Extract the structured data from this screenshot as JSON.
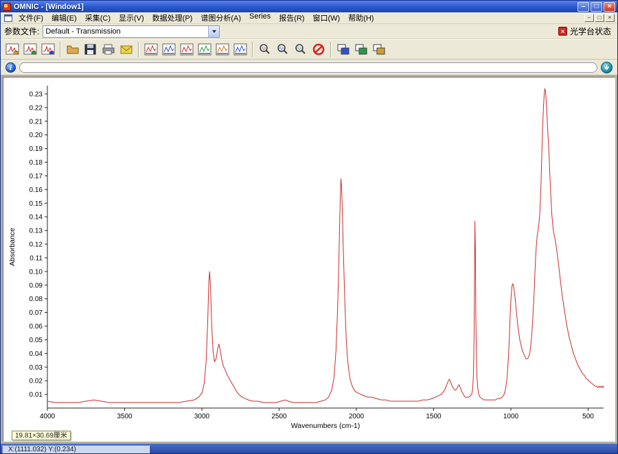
{
  "window": {
    "title": "OMNIC - [Window1]",
    "controls": {
      "minimize": "–",
      "restore": "□",
      "close": "×"
    }
  },
  "menu": {
    "items": [
      "文件(F)",
      "编辑(E)",
      "采集(C)",
      "显示(V)",
      "数据处理(P)",
      "谱图分析(A)",
      "Series",
      "报告(R)",
      "窗口(W)",
      "帮助(H)"
    ]
  },
  "mdi_controls": {
    "minimize": "–",
    "restore": "□",
    "close": "×"
  },
  "param_bar": {
    "label": "参数文件:",
    "selected": "Default - Transmission",
    "bench_status_label": "光学台状态"
  },
  "toolbar": {
    "groups": [
      [
        {
          "name": "experiment-setup-button",
          "icon": "spectrum-doc",
          "accent": "#e0a000"
        },
        {
          "name": "collect-background-button",
          "icon": "spectrum-doc",
          "accent": "#28a028"
        },
        {
          "name": "collect-sample-button",
          "icon": "spectrum-doc",
          "accent": "#2848d0"
        }
      ],
      [
        {
          "name": "open-button",
          "icon": "folder",
          "accent": "#dcaa50"
        },
        {
          "name": "save-button",
          "icon": "floppy",
          "accent": "#303850"
        },
        {
          "name": "print-button",
          "icon": "printer",
          "accent": "#9aa0a8"
        },
        {
          "name": "email-button",
          "icon": "mail",
          "accent": "#ecd24a"
        }
      ],
      [
        {
          "name": "full-scale-button",
          "icon": "chart",
          "accent": "#d03030"
        },
        {
          "name": "autoscale-button",
          "icon": "chart",
          "accent": "#3050d0"
        },
        {
          "name": "common-scale-button",
          "icon": "chart",
          "accent": "#d03030"
        },
        {
          "name": "match-scale-button",
          "icon": "chart",
          "accent": "#2a9a4a"
        },
        {
          "name": "offset-spectra-button",
          "icon": "chart",
          "accent": "#d07828"
        },
        {
          "name": "stack-spectra-button",
          "icon": "chart",
          "accent": "#3050d0"
        }
      ],
      [
        {
          "name": "find-peaks-button",
          "icon": "magnifier",
          "accent": "#d03030"
        },
        {
          "name": "zoom-button",
          "icon": "magnifier",
          "accent": "#3050d0"
        },
        {
          "name": "library-search-button",
          "icon": "magnifier",
          "accent": "#2a9a4a"
        },
        {
          "name": "spectral-id-button",
          "icon": "ban",
          "accent": "#d02020"
        }
      ],
      [
        {
          "name": "copy-window-button",
          "icon": "windows",
          "accent": "#3050d0"
        },
        {
          "name": "paste-window-button",
          "icon": "windows",
          "accent": "#2a9a4a"
        },
        {
          "name": "new-window-button",
          "icon": "windows",
          "accent": "#d0a030"
        }
      ]
    ]
  },
  "info_bar": {
    "value": ""
  },
  "chart_data": {
    "type": "line",
    "title": "",
    "xlabel": "Wavenumbers (cm-1)",
    "ylabel": "Absorbance",
    "x_axis_reversed": true,
    "x_range": [
      4000,
      400
    ],
    "x_ticks": [
      4000,
      3500,
      3000,
      2500,
      2000,
      1500,
      1000,
      500
    ],
    "y_min": 0.0,
    "y_max": 0.236,
    "y_ticks": [
      0.01,
      0.02,
      0.03,
      0.04,
      0.05,
      0.06,
      0.07,
      0.08,
      0.09,
      0.1,
      0.11,
      0.12,
      0.13,
      0.14,
      0.15,
      0.16,
      0.17,
      0.18,
      0.19,
      0.2,
      0.21,
      0.22,
      0.23
    ],
    "grid": false,
    "legend": false,
    "line_color": "#cc2a2a",
    "series_name": "IR absorbance spectrum",
    "points": [
      [
        4000,
        0.005
      ],
      [
        3950,
        0.004
      ],
      [
        3900,
        0.004
      ],
      [
        3850,
        0.004
      ],
      [
        3800,
        0.004
      ],
      [
        3750,
        0.005
      ],
      [
        3700,
        0.006
      ],
      [
        3650,
        0.005
      ],
      [
        3600,
        0.004
      ],
      [
        3550,
        0.004
      ],
      [
        3500,
        0.004
      ],
      [
        3450,
        0.004
      ],
      [
        3400,
        0.004
      ],
      [
        3350,
        0.004
      ],
      [
        3300,
        0.004
      ],
      [
        3250,
        0.004
      ],
      [
        3200,
        0.004
      ],
      [
        3150,
        0.004
      ],
      [
        3100,
        0.005
      ],
      [
        3050,
        0.006
      ],
      [
        3020,
        0.008
      ],
      [
        3000,
        0.011
      ],
      [
        2985,
        0.018
      ],
      [
        2972,
        0.035
      ],
      [
        2962,
        0.065
      ],
      [
        2955,
        0.092
      ],
      [
        2950,
        0.1
      ],
      [
        2944,
        0.088
      ],
      [
        2936,
        0.06
      ],
      [
        2928,
        0.042
      ],
      [
        2918,
        0.034
      ],
      [
        2908,
        0.036
      ],
      [
        2898,
        0.043
      ],
      [
        2890,
        0.047
      ],
      [
        2882,
        0.043
      ],
      [
        2872,
        0.036
      ],
      [
        2862,
        0.031
      ],
      [
        2850,
        0.028
      ],
      [
        2835,
        0.024
      ],
      [
        2820,
        0.021
      ],
      [
        2805,
        0.018
      ],
      [
        2790,
        0.015
      ],
      [
        2775,
        0.012
      ],
      [
        2760,
        0.01
      ],
      [
        2740,
        0.008
      ],
      [
        2720,
        0.007
      ],
      [
        2700,
        0.006
      ],
      [
        2670,
        0.005
      ],
      [
        2640,
        0.005
      ],
      [
        2600,
        0.004
      ],
      [
        2560,
        0.004
      ],
      [
        2520,
        0.004
      ],
      [
        2490,
        0.005
      ],
      [
        2460,
        0.006
      ],
      [
        2440,
        0.005
      ],
      [
        2410,
        0.004
      ],
      [
        2380,
        0.004
      ],
      [
        2350,
        0.004
      ],
      [
        2320,
        0.004
      ],
      [
        2290,
        0.004
      ],
      [
        2260,
        0.004
      ],
      [
        2230,
        0.005
      ],
      [
        2200,
        0.006
      ],
      [
        2180,
        0.008
      ],
      [
        2160,
        0.013
      ],
      [
        2145,
        0.022
      ],
      [
        2132,
        0.042
      ],
      [
        2122,
        0.072
      ],
      [
        2114,
        0.105
      ],
      [
        2108,
        0.138
      ],
      [
        2103,
        0.158
      ],
      [
        2100,
        0.168
      ],
      [
        2096,
        0.162
      ],
      [
        2091,
        0.145
      ],
      [
        2086,
        0.122
      ],
      [
        2080,
        0.098
      ],
      [
        2073,
        0.072
      ],
      [
        2066,
        0.052
      ],
      [
        2058,
        0.037
      ],
      [
        2050,
        0.028
      ],
      [
        2040,
        0.021
      ],
      [
        2030,
        0.017
      ],
      [
        2018,
        0.014
      ],
      [
        2005,
        0.012
      ],
      [
        1990,
        0.011
      ],
      [
        1970,
        0.01
      ],
      [
        1950,
        0.009
      ],
      [
        1925,
        0.008
      ],
      [
        1900,
        0.008
      ],
      [
        1870,
        0.007
      ],
      [
        1840,
        0.006
      ],
      [
        1810,
        0.006
      ],
      [
        1780,
        0.005
      ],
      [
        1750,
        0.005
      ],
      [
        1720,
        0.005
      ],
      [
        1690,
        0.005
      ],
      [
        1660,
        0.005
      ],
      [
        1630,
        0.005
      ],
      [
        1600,
        0.005
      ],
      [
        1570,
        0.006
      ],
      [
        1540,
        0.006
      ],
      [
        1510,
        0.007
      ],
      [
        1490,
        0.008
      ],
      [
        1470,
        0.009
      ],
      [
        1450,
        0.01
      ],
      [
        1430,
        0.013
      ],
      [
        1415,
        0.017
      ],
      [
        1405,
        0.02
      ],
      [
        1398,
        0.021
      ],
      [
        1390,
        0.019
      ],
      [
        1380,
        0.016
      ],
      [
        1370,
        0.014
      ],
      [
        1360,
        0.013
      ],
      [
        1350,
        0.014
      ],
      [
        1342,
        0.016
      ],
      [
        1336,
        0.017
      ],
      [
        1328,
        0.015
      ],
      [
        1318,
        0.012
      ],
      [
        1308,
        0.01
      ],
      [
        1296,
        0.008
      ],
      [
        1284,
        0.008
      ],
      [
        1272,
        0.008
      ],
      [
        1262,
        0.009
      ],
      [
        1254,
        0.01
      ],
      [
        1247,
        0.014
      ],
      [
        1242,
        0.025
      ],
      [
        1238,
        0.055
      ],
      [
        1235,
        0.1
      ],
      [
        1233,
        0.137
      ],
      [
        1230,
        0.115
      ],
      [
        1227,
        0.07
      ],
      [
        1223,
        0.038
      ],
      [
        1219,
        0.022
      ],
      [
        1214,
        0.014
      ],
      [
        1208,
        0.01
      ],
      [
        1200,
        0.008
      ],
      [
        1188,
        0.007
      ],
      [
        1175,
        0.006
      ],
      [
        1160,
        0.006
      ],
      [
        1145,
        0.006
      ],
      [
        1130,
        0.006
      ],
      [
        1115,
        0.006
      ],
      [
        1100,
        0.006
      ],
      [
        1085,
        0.007
      ],
      [
        1070,
        0.007
      ],
      [
        1056,
        0.008
      ],
      [
        1044,
        0.01
      ],
      [
        1034,
        0.014
      ],
      [
        1025,
        0.022
      ],
      [
        1017,
        0.035
      ],
      [
        1010,
        0.052
      ],
      [
        1004,
        0.07
      ],
      [
        998,
        0.083
      ],
      [
        992,
        0.09
      ],
      [
        987,
        0.091
      ],
      [
        981,
        0.088
      ],
      [
        974,
        0.082
      ],
      [
        966,
        0.073
      ],
      [
        958,
        0.063
      ],
      [
        950,
        0.056
      ],
      [
        942,
        0.05
      ],
      [
        934,
        0.046
      ],
      [
        926,
        0.042
      ],
      [
        918,
        0.04
      ],
      [
        910,
        0.038
      ],
      [
        902,
        0.036
      ],
      [
        894,
        0.036
      ],
      [
        886,
        0.037
      ],
      [
        878,
        0.04
      ],
      [
        871,
        0.046
      ],
      [
        864,
        0.055
      ],
      [
        857,
        0.068
      ],
      [
        850,
        0.084
      ],
      [
        844,
        0.1
      ],
      [
        839,
        0.112
      ],
      [
        834,
        0.121
      ],
      [
        829,
        0.127
      ],
      [
        824,
        0.13
      ],
      [
        819,
        0.134
      ],
      [
        814,
        0.141
      ],
      [
        809,
        0.152
      ],
      [
        804,
        0.168
      ],
      [
        799,
        0.188
      ],
      [
        794,
        0.207
      ],
      [
        789,
        0.221
      ],
      [
        784,
        0.23
      ],
      [
        780,
        0.234
      ],
      [
        776,
        0.232
      ],
      [
        772,
        0.226
      ],
      [
        768,
        0.218
      ],
      [
        763,
        0.207
      ],
      [
        758,
        0.196
      ],
      [
        752,
        0.183
      ],
      [
        746,
        0.167
      ],
      [
        740,
        0.152
      ],
      [
        735,
        0.142
      ],
      [
        730,
        0.135
      ],
      [
        725,
        0.13
      ],
      [
        720,
        0.127
      ],
      [
        713,
        0.123
      ],
      [
        706,
        0.118
      ],
      [
        699,
        0.112
      ],
      [
        691,
        0.105
      ],
      [
        683,
        0.097
      ],
      [
        675,
        0.089
      ],
      [
        667,
        0.082
      ],
      [
        659,
        0.076
      ],
      [
        650,
        0.069
      ],
      [
        641,
        0.062
      ],
      [
        632,
        0.057
      ],
      [
        623,
        0.052
      ],
      [
        614,
        0.048
      ],
      [
        605,
        0.044
      ],
      [
        595,
        0.04
      ],
      [
        585,
        0.037
      ],
      [
        575,
        0.034
      ],
      [
        565,
        0.031
      ],
      [
        555,
        0.029
      ],
      [
        545,
        0.027
      ],
      [
        535,
        0.025
      ],
      [
        525,
        0.024
      ],
      [
        515,
        0.022
      ],
      [
        505,
        0.021
      ],
      [
        495,
        0.02
      ],
      [
        485,
        0.019
      ],
      [
        475,
        0.018
      ],
      [
        465,
        0.017
      ],
      [
        455,
        0.016
      ],
      [
        445,
        0.016
      ],
      [
        437,
        0.015
      ],
      [
        430,
        0.016
      ],
      [
        423,
        0.015
      ],
      [
        416,
        0.016
      ],
      [
        409,
        0.015
      ],
      [
        403,
        0.016
      ],
      [
        400,
        0.015
      ]
    ]
  },
  "size_tooltip": "19.81×30.69厘米",
  "status_bar": {
    "coords": "X:(1111.032) Y:(0.234)"
  }
}
